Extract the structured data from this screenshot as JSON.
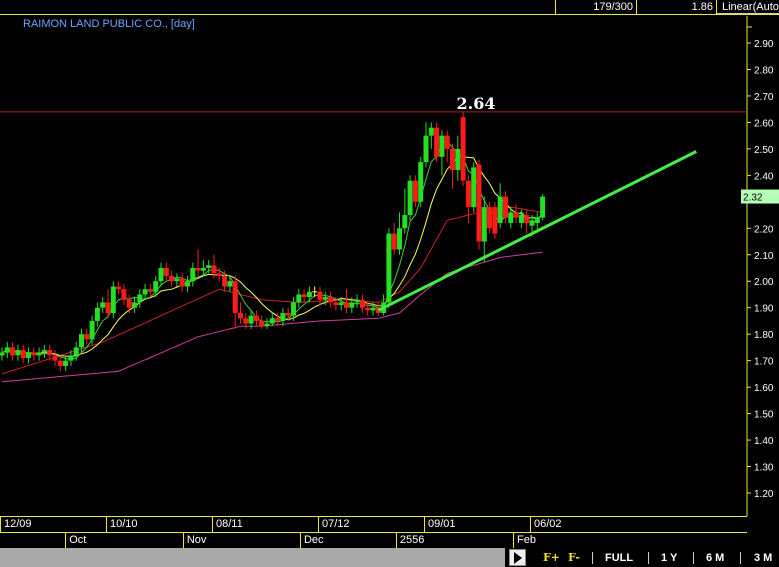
{
  "topbar": {
    "bars_count": "179/300",
    "value": "1.86",
    "scale_mode": "Linear(Auto"
  },
  "chart_title": "RAIMON LAND PUBLIC CO., [day]",
  "colors": {
    "up": "#22e022",
    "down": "#ff1a1a",
    "ma_fast": "#44cc44",
    "ma_mid": "#ffff55",
    "ma_slow": "#cc2222",
    "ma_long": "#d63c9c",
    "trendline": "#44ee44",
    "resistance": "#b02020",
    "axis": "#e8e83a",
    "last_price_bg": "#b6ffb6"
  },
  "chart_data": {
    "type": "candlestick",
    "title": "RAIMON LAND PUBLIC CO., [day]",
    "ylim": [
      1.1,
      2.95
    ],
    "yticks": [
      "2.90",
      "2.80",
      "2.70",
      "2.60",
      "2.50",
      "2.40",
      "2.20",
      "2.10",
      "2.00",
      "1.90",
      "1.80",
      "1.70",
      "1.60",
      "1.50",
      "1.40",
      "1.30",
      "1.20"
    ],
    "last_price": "2.32",
    "resistance": {
      "value": 2.64,
      "label": "2.64"
    },
    "date_ticks": [
      {
        "label": "12/09",
        "index": 0
      },
      {
        "label": "10/10",
        "index": 20
      },
      {
        "label": "08/11",
        "index": 40
      },
      {
        "label": "07/12",
        "index": 60
      },
      {
        "label": "09/01",
        "index": 80
      },
      {
        "label": "06/02",
        "index": 100
      }
    ],
    "month_ticks": [
      {
        "label": "Oct",
        "index": 12.3
      },
      {
        "label": "Nov",
        "index": 34.5
      },
      {
        "label": "Dec",
        "index": 56.6
      },
      {
        "label": "2556",
        "index": 74.7
      },
      {
        "label": "Feb",
        "index": 96.8
      }
    ],
    "ohlc": [
      [
        1.72,
        1.75,
        1.7,
        1.73
      ],
      [
        1.73,
        1.77,
        1.71,
        1.75
      ],
      [
        1.75,
        1.77,
        1.7,
        1.72
      ],
      [
        1.72,
        1.76,
        1.7,
        1.74
      ],
      [
        1.74,
        1.76,
        1.69,
        1.71
      ],
      [
        1.71,
        1.75,
        1.69,
        1.73
      ],
      [
        1.73,
        1.75,
        1.7,
        1.72
      ],
      [
        1.72,
        1.75,
        1.7,
        1.73
      ],
      [
        1.73,
        1.76,
        1.71,
        1.74
      ],
      [
        1.74,
        1.76,
        1.7,
        1.72
      ],
      [
        1.72,
        1.74,
        1.68,
        1.7
      ],
      [
        1.7,
        1.72,
        1.66,
        1.68
      ],
      [
        1.68,
        1.72,
        1.66,
        1.7
      ],
      [
        1.7,
        1.74,
        1.68,
        1.72
      ],
      [
        1.72,
        1.77,
        1.7,
        1.75
      ],
      [
        1.75,
        1.82,
        1.73,
        1.8
      ],
      [
        1.8,
        1.82,
        1.76,
        1.78
      ],
      [
        1.78,
        1.87,
        1.76,
        1.85
      ],
      [
        1.85,
        1.92,
        1.83,
        1.9
      ],
      [
        1.9,
        1.94,
        1.88,
        1.92
      ],
      [
        1.92,
        1.97,
        1.86,
        1.88
      ],
      [
        1.88,
        2.0,
        1.86,
        1.98
      ],
      [
        1.98,
        2.0,
        1.95,
        1.97
      ],
      [
        1.97,
        1.99,
        1.91,
        1.93
      ],
      [
        1.93,
        1.95,
        1.88,
        1.9
      ],
      [
        1.9,
        1.94,
        1.88,
        1.92
      ],
      [
        1.92,
        1.97,
        1.9,
        1.95
      ],
      [
        1.95,
        1.99,
        1.93,
        1.97
      ],
      [
        1.97,
        1.99,
        1.94,
        1.96
      ],
      [
        1.96,
        2.02,
        1.94,
        2.0
      ],
      [
        2.0,
        2.07,
        1.98,
        2.05
      ],
      [
        2.05,
        2.07,
        2.0,
        2.02
      ],
      [
        2.02,
        2.04,
        1.98,
        2.0
      ],
      [
        2.0,
        2.03,
        1.98,
        2.01
      ],
      [
        2.01,
        2.03,
        1.96,
        1.98
      ],
      [
        1.98,
        2.02,
        1.96,
        2.0
      ],
      [
        2.0,
        2.07,
        1.98,
        2.05
      ],
      [
        2.05,
        2.12,
        2.02,
        2.04
      ],
      [
        2.04,
        2.08,
        2.02,
        2.05
      ],
      [
        2.05,
        2.08,
        2.03,
        2.06
      ],
      [
        2.06,
        2.1,
        2.01,
        2.03
      ],
      [
        2.03,
        2.05,
        2.0,
        2.02
      ],
      [
        2.02,
        2.04,
        1.96,
        1.98
      ],
      [
        1.98,
        2.02,
        1.96,
        2.0
      ],
      [
        2.0,
        2.02,
        1.82,
        1.88
      ],
      [
        1.88,
        1.92,
        1.84,
        1.86
      ],
      [
        1.86,
        1.88,
        1.82,
        1.84
      ],
      [
        1.84,
        1.89,
        1.82,
        1.87
      ],
      [
        1.87,
        1.89,
        1.83,
        1.85
      ],
      [
        1.85,
        1.87,
        1.82,
        1.83
      ],
      [
        1.83,
        1.86,
        1.82,
        1.84
      ],
      [
        1.84,
        1.88,
        1.83,
        1.86
      ],
      [
        1.86,
        1.88,
        1.83,
        1.85
      ],
      [
        1.85,
        1.9,
        1.83,
        1.88
      ],
      [
        1.88,
        1.9,
        1.85,
        1.87
      ],
      [
        1.87,
        1.94,
        1.85,
        1.92
      ],
      [
        1.92,
        1.97,
        1.9,
        1.95
      ],
      [
        1.95,
        1.97,
        1.92,
        1.94
      ],
      [
        1.94,
        1.98,
        1.92,
        1.96
      ],
      [
        1.96,
        1.98,
        1.94,
        1.96
      ],
      [
        1.96,
        1.98,
        1.91,
        1.93
      ],
      [
        1.93,
        1.96,
        1.91,
        1.94
      ],
      [
        1.94,
        1.96,
        1.9,
        1.92
      ],
      [
        1.92,
        1.94,
        1.89,
        1.91
      ],
      [
        1.91,
        1.94,
        1.89,
        1.92
      ],
      [
        1.92,
        1.97,
        1.88,
        1.9
      ],
      [
        1.9,
        1.94,
        1.88,
        1.92
      ],
      [
        1.92,
        1.95,
        1.9,
        1.93
      ],
      [
        1.93,
        1.95,
        1.88,
        1.9
      ],
      [
        1.9,
        1.92,
        1.87,
        1.89
      ],
      [
        1.89,
        1.92,
        1.87,
        1.9
      ],
      [
        1.9,
        1.92,
        1.87,
        1.88
      ],
      [
        1.88,
        1.95,
        1.87,
        1.92
      ],
      [
        1.92,
        2.2,
        1.9,
        2.18
      ],
      [
        2.18,
        2.22,
        2.1,
        2.12
      ],
      [
        2.12,
        2.26,
        2.1,
        2.2
      ],
      [
        2.2,
        2.35,
        2.18,
        2.25
      ],
      [
        2.25,
        2.4,
        2.23,
        2.38
      ],
      [
        2.38,
        2.4,
        2.28,
        2.3
      ],
      [
        2.3,
        2.47,
        2.28,
        2.45
      ],
      [
        2.45,
        2.6,
        2.43,
        2.55
      ],
      [
        2.55,
        2.6,
        2.5,
        2.58
      ],
      [
        2.58,
        2.6,
        2.45,
        2.47
      ],
      [
        2.47,
        2.57,
        2.4,
        2.55
      ],
      [
        2.55,
        2.57,
        2.45,
        2.5
      ],
      [
        2.5,
        2.52,
        2.35,
        2.42
      ],
      [
        2.42,
        2.55,
        2.38,
        2.5
      ],
      [
        2.62,
        2.64,
        2.36,
        2.38
      ],
      [
        2.38,
        2.4,
        2.22,
        2.28
      ],
      [
        2.28,
        2.45,
        2.26,
        2.43
      ],
      [
        2.44,
        2.46,
        2.12,
        2.15
      ],
      [
        2.15,
        2.32,
        2.07,
        2.28
      ],
      [
        2.28,
        2.3,
        2.18,
        2.2
      ],
      [
        2.28,
        2.3,
        2.16,
        2.18
      ],
      [
        2.22,
        2.37,
        2.2,
        2.32
      ],
      [
        2.32,
        2.34,
        2.22,
        2.24
      ],
      [
        2.22,
        2.28,
        2.2,
        2.26
      ],
      [
        2.26,
        2.29,
        2.22,
        2.24
      ],
      [
        2.22,
        2.27,
        2.2,
        2.25
      ],
      [
        2.25,
        2.27,
        2.18,
        2.22
      ],
      [
        2.21,
        2.25,
        2.17,
        2.23
      ],
      [
        2.22,
        2.26,
        2.19,
        2.24
      ],
      [
        2.24,
        2.33,
        2.23,
        2.32
      ]
    ],
    "ma_fast_period": 5,
    "ma_mid_period": 10,
    "ma_slow": [
      [
        0,
        1.65
      ],
      [
        19,
        1.77
      ],
      [
        41,
        1.97
      ],
      [
        49,
        1.93
      ],
      [
        56,
        1.92
      ],
      [
        64,
        1.93
      ],
      [
        71,
        1.92
      ],
      [
        75,
        1.96
      ],
      [
        79,
        2.05
      ],
      [
        84,
        2.23
      ],
      [
        90,
        2.26
      ],
      [
        96,
        2.28
      ],
      [
        102,
        2.26
      ]
    ],
    "ma_long": [
      [
        0,
        1.62
      ],
      [
        22,
        1.66
      ],
      [
        37,
        1.79
      ],
      [
        45,
        1.83
      ],
      [
        49,
        1.83
      ],
      [
        60,
        1.85
      ],
      [
        71,
        1.86
      ],
      [
        75,
        1.88
      ],
      [
        79,
        1.95
      ],
      [
        84,
        2.03
      ],
      [
        94,
        2.09
      ],
      [
        102,
        2.11
      ]
    ],
    "trendline": {
      "from": {
        "index": 71,
        "price": 1.89
      },
      "to": {
        "index": 131,
        "price": 2.49
      }
    }
  },
  "bottom": {
    "fplus": "F+",
    "fminus": "F-",
    "full": "FULL",
    "y1": "1 Y",
    "m6": "6 M",
    "m3": "3 M"
  }
}
